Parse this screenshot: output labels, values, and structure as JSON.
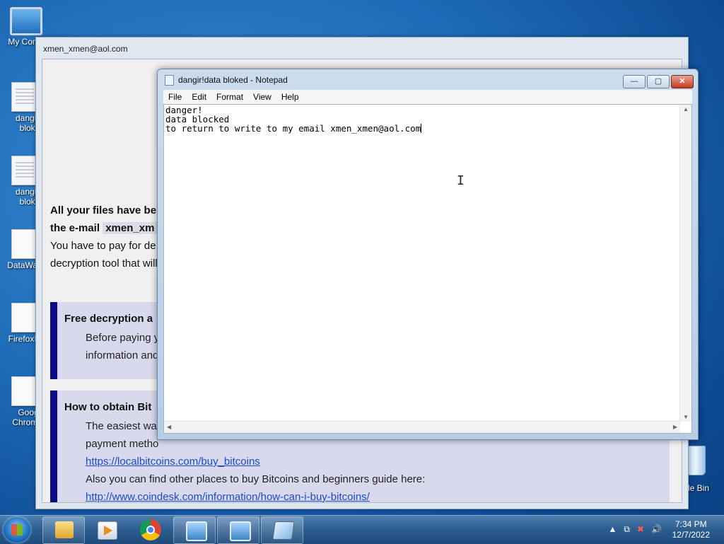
{
  "desktop": {
    "icons": [
      {
        "label": "My Comp"
      },
      {
        "label": "dangir!c bloke"
      },
      {
        "label": "dangir!c bloke"
      },
      {
        "label": "DataWag"
      },
      {
        "label": "FirefoxIn"
      },
      {
        "label": "Goog Chromel"
      }
    ],
    "recycle_bin_label": "cle Bin"
  },
  "ransom_window": {
    "title": "xmen_xmen@aol.com",
    "line1": "All your files have be",
    "line2_prefix": "the e-mail",
    "line2_email": "xmen_xm",
    "line3": "You have to pay for de",
    "line4": "decryption tool that will",
    "box1": {
      "heading": "Free decryption a",
      "p1": "Before paying y",
      "p2": "information and"
    },
    "box2": {
      "heading": "How to obtain Bit",
      "p1": "The easiest way",
      "p2": "payment metho",
      "link1": "https://localbitcoins.com/buy_bitcoins",
      "p3": "Also you can find other places to buy Bitcoins and beginners guide here:",
      "link2": "http://www.coindesk.com/information/how-can-i-buy-bitcoins/"
    }
  },
  "notepad": {
    "title": "dangir!data bloked - Notepad",
    "menu": [
      "File",
      "Edit",
      "Format",
      "View",
      "Help"
    ],
    "lines": [
      "danger!",
      "data blocked",
      "to return to write to my email xmen_xmen@aol.com"
    ],
    "controls": {
      "minimize": "—",
      "maximize": "▢",
      "close": "✕"
    }
  },
  "taskbar": {
    "items": [
      "start-button",
      "explorer",
      "media-player",
      "chrome",
      "network-computer-1",
      "network-computer-2",
      "notepad"
    ],
    "time": "7:34 PM",
    "date": "12/7/2022",
    "tray": [
      "▲",
      "⧉",
      "✖",
      "🔊"
    ]
  }
}
